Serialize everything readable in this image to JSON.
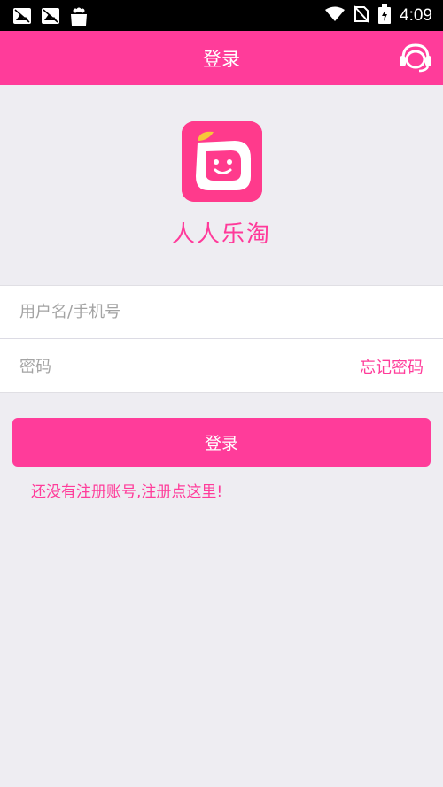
{
  "status_bar": {
    "time": "4:09",
    "notification_icons": [
      "image-notification-icon",
      "image-notification-icon",
      "shopping-bag-icon"
    ],
    "system_icons": [
      "wifi-icon",
      "no-sim-icon",
      "battery-charging-icon"
    ]
  },
  "header": {
    "title": "登录",
    "support_icon": "customer-service-headset-icon"
  },
  "brand": {
    "name": "人人乐淘",
    "logo_icon": "smiley-face-logo-icon"
  },
  "form": {
    "username_placeholder": "用户名/手机号",
    "password_placeholder": "密码",
    "forgot_password_label": "忘记密码"
  },
  "actions": {
    "login_label": "登录",
    "register_prompt": "还没有注册账号,注册点这里!"
  },
  "colors": {
    "accent": "#ff3c9a",
    "background": "#eeedf2",
    "status_bar": "#000000"
  }
}
